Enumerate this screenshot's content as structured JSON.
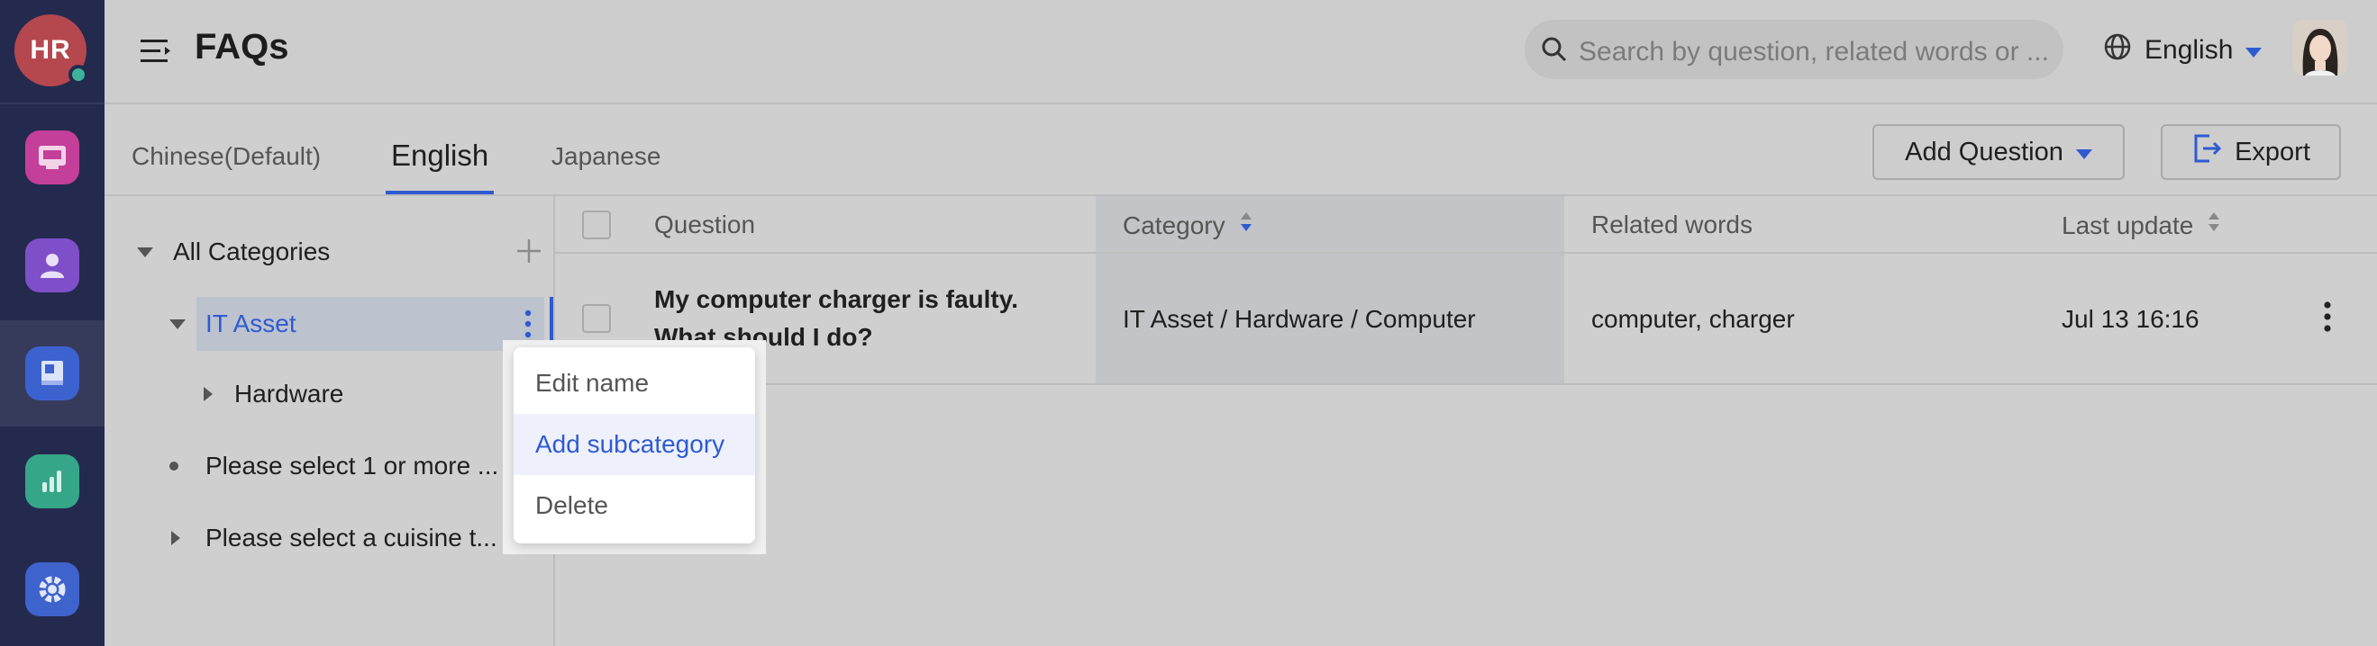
{
  "rail": {
    "user_initials": "HR",
    "items": [
      {
        "icon": "inbox-icon",
        "color": "#c43f9a"
      },
      {
        "icon": "person-icon",
        "color": "#7e4fc9"
      },
      {
        "icon": "knowledge-book-icon",
        "color": "#3c62cf"
      },
      {
        "icon": "analytics-bar-icon",
        "color": "#36a689"
      },
      {
        "icon": "gear-icon",
        "color": "#3f63cc"
      }
    ]
  },
  "header": {
    "title": "FAQs",
    "search_placeholder": "Search by question, related words or ...",
    "language": "English"
  },
  "tabs": [
    "Chinese(Default)",
    "English",
    "Japanese"
  ],
  "active_tab": "English",
  "actions": {
    "add_question": "Add Question",
    "export": "Export"
  },
  "tree": {
    "root": "All Categories",
    "selected": "IT Asset",
    "child": "Hardware",
    "item3": "Please select 1 or more ...",
    "item4": "Please select a cuisine t..."
  },
  "table": {
    "columns": {
      "question": "Question",
      "category": "Category",
      "related": "Related words",
      "updated": "Last update"
    },
    "rows": [
      {
        "question_line1": "My computer charger is faulty.",
        "question_line2": "What should I do?",
        "category": "IT Asset / Hardware / Computer",
        "related": "computer, charger",
        "updated": "Jul 13 16:16"
      }
    ]
  },
  "context_menu": {
    "items": [
      "Edit name",
      "Add subcategory",
      "Delete"
    ],
    "highlighted": "Add subcategory"
  },
  "colors": {
    "accent": "#2f5bd1",
    "rail_bg": "#242a4e",
    "overlay_bg": "#cdcdcd"
  }
}
